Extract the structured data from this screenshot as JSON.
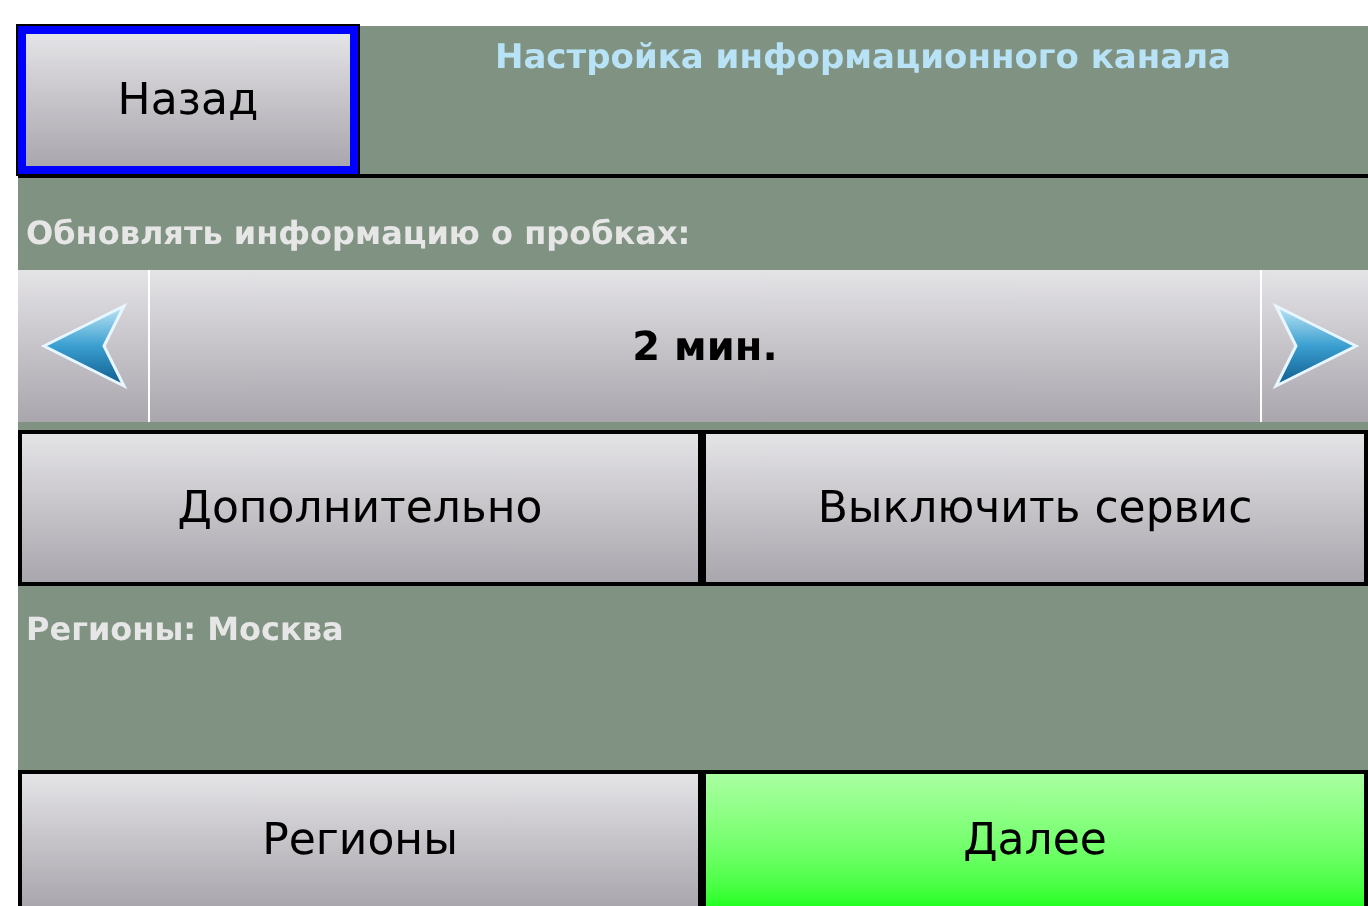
{
  "back_button": {
    "label": "Назад",
    "focused": true
  },
  "title": "Настройка информационного канала",
  "update_label": "Обновлять информацию о пробках:",
  "interval": {
    "value": "2 мин."
  },
  "option_buttons": [
    {
      "label": "Дополнительно",
      "kind": "normal"
    },
    {
      "label": "Выключить сервис",
      "kind": "normal"
    }
  ],
  "regions_text": "Регионы: Москва",
  "bottom_buttons": [
    {
      "label": "Регионы",
      "kind": "normal"
    },
    {
      "label": "Далее",
      "kind": "accent"
    }
  ]
}
